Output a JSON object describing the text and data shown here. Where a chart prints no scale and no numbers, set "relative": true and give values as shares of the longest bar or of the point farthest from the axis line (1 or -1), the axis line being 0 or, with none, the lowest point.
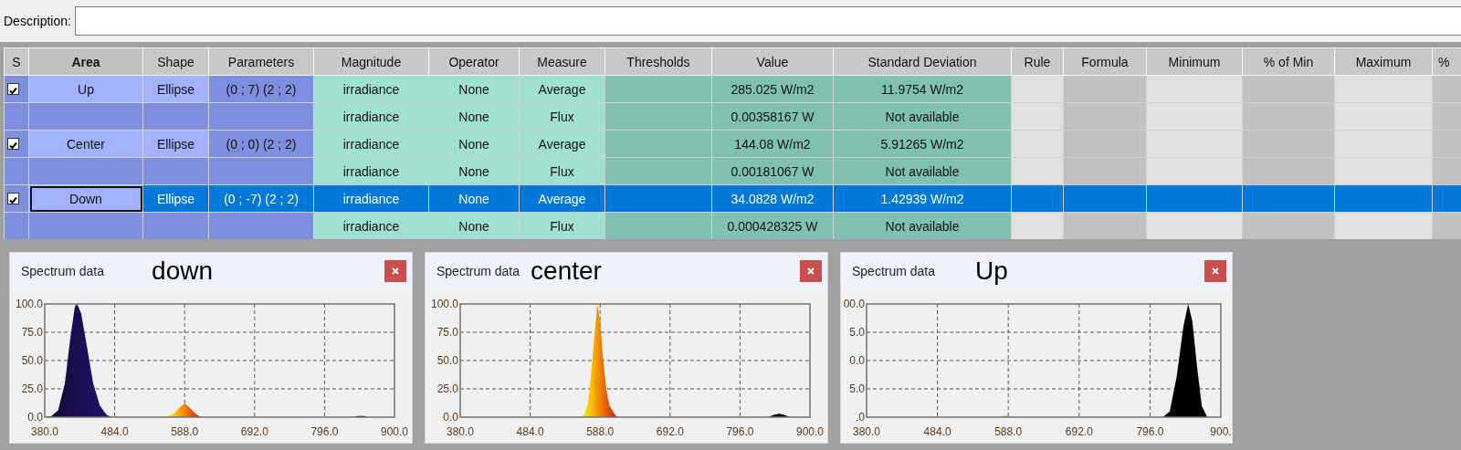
{
  "description": {
    "label": "Description:"
  },
  "table": {
    "columns": [
      {
        "label": "S",
        "selected": false
      },
      {
        "label": "Area",
        "selected": true
      },
      {
        "label": "Shape",
        "selected": false
      },
      {
        "label": "Parameters",
        "selected": false
      },
      {
        "label": "Magnitude",
        "selected": false
      },
      {
        "label": "Operator",
        "selected": false
      },
      {
        "label": "Measure",
        "selected": false
      },
      {
        "label": "Thresholds",
        "selected": false
      },
      {
        "label": "Value",
        "selected": false
      },
      {
        "label": "Standard Deviation",
        "selected": false
      },
      {
        "label": "Rule",
        "selected": false
      },
      {
        "label": "Formula",
        "selected": false
      },
      {
        "label": "Minimum",
        "selected": false
      },
      {
        "label": "% of Min",
        "selected": false
      },
      {
        "label": "Maximum",
        "selected": false
      },
      {
        "label": "%",
        "selected": false
      }
    ],
    "rows": [
      {
        "kind": "area",
        "selected": false,
        "checked": true,
        "focused": false,
        "area": "Up",
        "shape": "Ellipse",
        "parameters": "(0 ; 7) (2 ; 2)",
        "magnitude": "irradiance",
        "operator": "None",
        "measure": "Average",
        "value": "285.025 W/m2",
        "std_dev": "11.9754 W/m2"
      },
      {
        "kind": "measure",
        "selected": false,
        "magnitude": "irradiance",
        "operator": "None",
        "measure": "Flux",
        "value": "0.00358167 W",
        "std_dev": "Not available"
      },
      {
        "kind": "area",
        "selected": false,
        "checked": true,
        "focused": false,
        "area": "Center",
        "shape": "Ellipse",
        "parameters": "(0 ; 0) (2 ; 2)",
        "magnitude": "irradiance",
        "operator": "None",
        "measure": "Average",
        "value": "144.08 W/m2",
        "std_dev": "5.91265 W/m2"
      },
      {
        "kind": "measure",
        "selected": false,
        "magnitude": "irradiance",
        "operator": "None",
        "measure": "Flux",
        "value": "0.00181067 W",
        "std_dev": "Not available"
      },
      {
        "kind": "area",
        "selected": true,
        "checked": true,
        "focused": true,
        "area": "Down",
        "shape": "Ellipse",
        "parameters": "(0 ; -7) (2 ; 2)",
        "magnitude": "irradiance",
        "operator": "None",
        "measure": "Average",
        "value": "34.0828 W/m2",
        "std_dev": "1.42939 W/m2"
      },
      {
        "kind": "measure",
        "selected": false,
        "magnitude": "irradiance",
        "operator": "None",
        "measure": "Flux",
        "value": "0.000428325 W",
        "std_dev": "Not available"
      }
    ]
  },
  "panels": [
    {
      "title": "Spectrum data",
      "annotation": "down",
      "chart_data": {
        "type": "area",
        "grid": true,
        "xlim": [
          380,
          900
        ],
        "ylim": [
          0,
          100
        ],
        "xticks": [
          {
            "value": 380,
            "label": "380.0"
          },
          {
            "value": 484,
            "label": "484.0"
          },
          {
            "value": 588,
            "label": "588.0"
          },
          {
            "value": 692,
            "label": "692.0"
          },
          {
            "value": 796,
            "label": "796.0"
          },
          {
            "value": 900,
            "label": "900.0"
          }
        ],
        "yticks": [
          {
            "value": 0,
            "label": "0.0"
          },
          {
            "value": 25,
            "label": "25.0"
          },
          {
            "value": 50,
            "label": "50.0"
          },
          {
            "value": 75,
            "label": "75.0"
          },
          {
            "value": 100,
            "label": "100.0"
          }
        ],
        "x": [
          380,
          390,
          400,
          410,
          418,
          425,
          428,
          434,
          442,
          452,
          462,
          472,
          480,
          560,
          572,
          580,
          588,
          596,
          604,
          612,
          840,
          845,
          855,
          860,
          900
        ],
        "values": [
          0,
          1,
          6,
          30,
          70,
          98,
          100,
          92,
          65,
          30,
          10,
          2,
          0,
          0,
          3,
          8,
          12,
          8,
          3,
          0,
          0,
          1,
          1,
          0,
          0
        ]
      }
    },
    {
      "title": "Spectrum data",
      "annotation": "center",
      "chart_data": {
        "type": "area",
        "grid": true,
        "xlim": [
          380,
          900
        ],
        "ylim": [
          0,
          100
        ],
        "xticks": [
          {
            "value": 380,
            "label": "380.0"
          },
          {
            "value": 484,
            "label": "484.0"
          },
          {
            "value": 588,
            "label": "588.0"
          },
          {
            "value": 692,
            "label": "692.0"
          },
          {
            "value": 796,
            "label": "796.0"
          },
          {
            "value": 900,
            "label": "900.0"
          }
        ],
        "yticks": [
          {
            "value": 0,
            "label": "0.0"
          },
          {
            "value": 25,
            "label": "25.0"
          },
          {
            "value": 50,
            "label": "50.0"
          },
          {
            "value": 75,
            "label": "75.0"
          },
          {
            "value": 100,
            "label": "100.0"
          }
        ],
        "x": [
          380,
          560,
          565,
          570,
          575,
          580,
          584,
          588,
          592,
          597,
          602,
          608,
          613,
          838,
          846,
          854,
          862,
          870,
          900
        ],
        "values": [
          0,
          0,
          3,
          12,
          40,
          75,
          100,
          85,
          55,
          25,
          10,
          4,
          0,
          0,
          2,
          3,
          2,
          0,
          0
        ]
      }
    },
    {
      "title": "Spectrum data",
      "annotation": "Up",
      "y_axis_labels": [
        "00.0",
        "5.0",
        "0.0",
        "5.0",
        ".0"
      ],
      "chart_data": {
        "type": "area",
        "grid": true,
        "relative": true,
        "xlim": [
          380,
          900
        ],
        "xticks": [
          {
            "value": 380,
            "label": "380.0"
          },
          {
            "value": 484,
            "label": "484.0"
          },
          {
            "value": 588,
            "label": "588.0"
          },
          {
            "value": 692,
            "label": "692.0"
          },
          {
            "value": 796,
            "label": "796.0"
          },
          {
            "value": 900,
            "label": "900."
          }
        ],
        "x": [
          380,
          578,
          579,
          588,
          589,
          815,
          825,
          835,
          845,
          852,
          858,
          865,
          872,
          880,
          900
        ],
        "values": [
          0,
          0,
          0.01,
          0.01,
          0,
          0,
          0.05,
          0.35,
          0.8,
          1,
          0.85,
          0.45,
          0.1,
          0,
          0
        ]
      }
    }
  ]
}
